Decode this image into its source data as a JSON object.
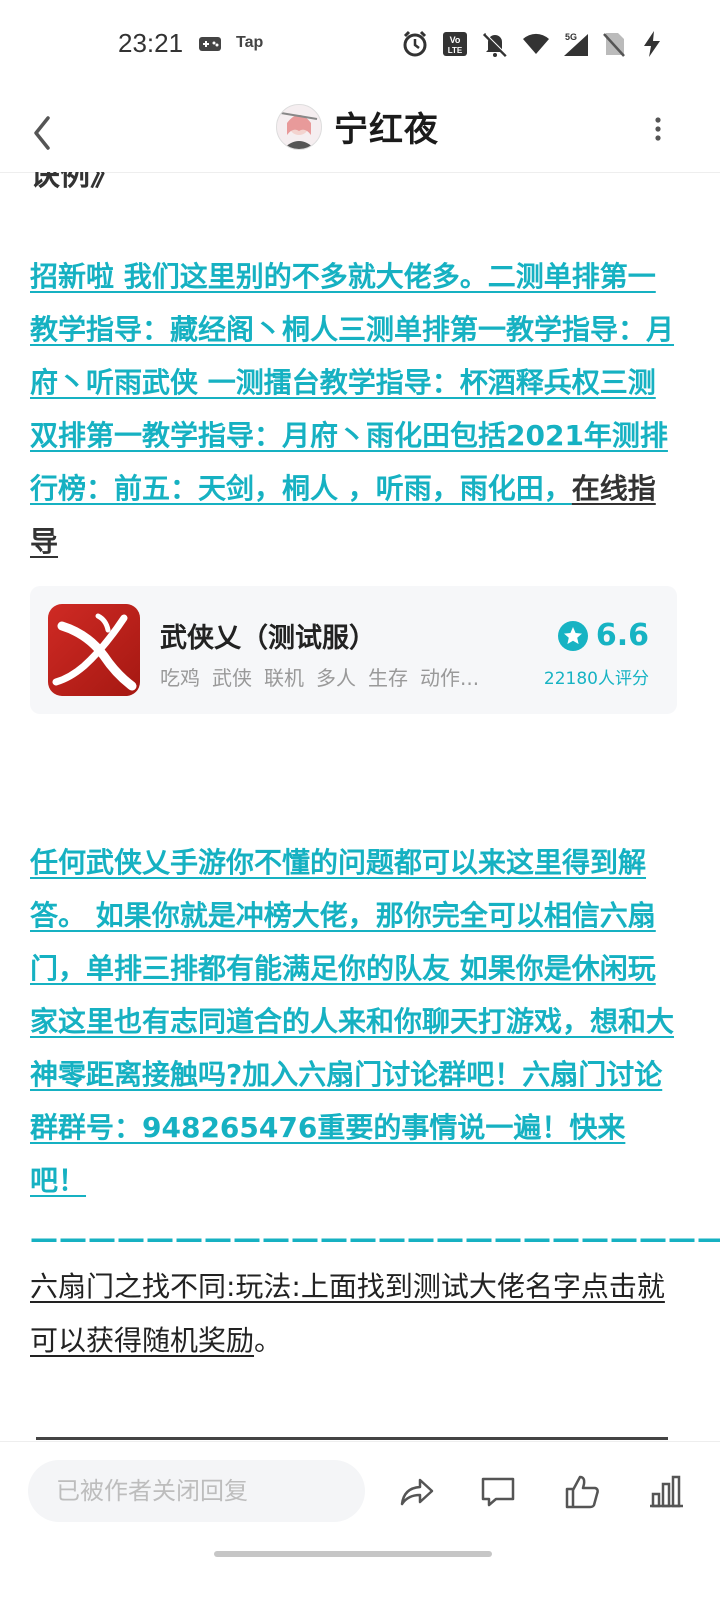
{
  "status_bar": {
    "time": "23:21",
    "tap_label": "Tap",
    "icons": [
      "gamepad-icon",
      "alarm-icon",
      "volte-icon",
      "mute-icon",
      "wifi-icon",
      "signal-5g-icon",
      "no-sim-icon",
      "charging-icon"
    ],
    "network_label": "5G"
  },
  "header": {
    "title": "宁红夜",
    "back_icon": "chevron-left-icon",
    "more_icon": "more-vertical-icon"
  },
  "content": {
    "cut_text": "诀例》",
    "paragraph1_link": "招新啦 我们这里别的不多就大佬多。二测单排第一教学指导：藏经阁丶桐人三测单排第一教学指导：月府丶听雨武侠 一测擂台教学指导：杯酒释兵权三测双排第一教学指导：月府丶雨化田包括2021年测排行榜：前五：天剑，桐人 ，听雨，雨化田，",
    "paragraph1_dark": "在线指导",
    "app_card": {
      "name": "武侠乂（测试服）",
      "tags": [
        "吃鸡",
        "武侠",
        "联机",
        "多人",
        "生存",
        "动作..."
      ],
      "rating": "6.6",
      "rating_count": "22180人评分",
      "accent_color": "#17b3c3"
    },
    "paragraph2_link": "任何武侠乂手游你不懂的问题都可以来这里得到解答。 如果你就是冲榜大佬，那你完全可以相信六扇门，单排三排都有能满足你的队友 如果你是休闲玩家这里也有志同道合的人来和你聊天打游戏，想和大神零距离接触吗?加入六扇门讨论群吧！六扇门讨论群群号：948265476重要的事情说一遍！快来吧！ ",
    "dash_line": "————————————————————————",
    "paragraph3_underlined": "六扇门之找不同:玩法:上面找到测试大佬名字点击就可以获得随机奖励",
    "paragraph3_end": "。"
  },
  "bottom_bar": {
    "reply_placeholder": "已被作者关闭回复",
    "icons": [
      "share-icon",
      "comment-icon",
      "like-icon",
      "stats-icon"
    ]
  },
  "colors": {
    "accent": "#16b1c2",
    "text": "#222222"
  }
}
